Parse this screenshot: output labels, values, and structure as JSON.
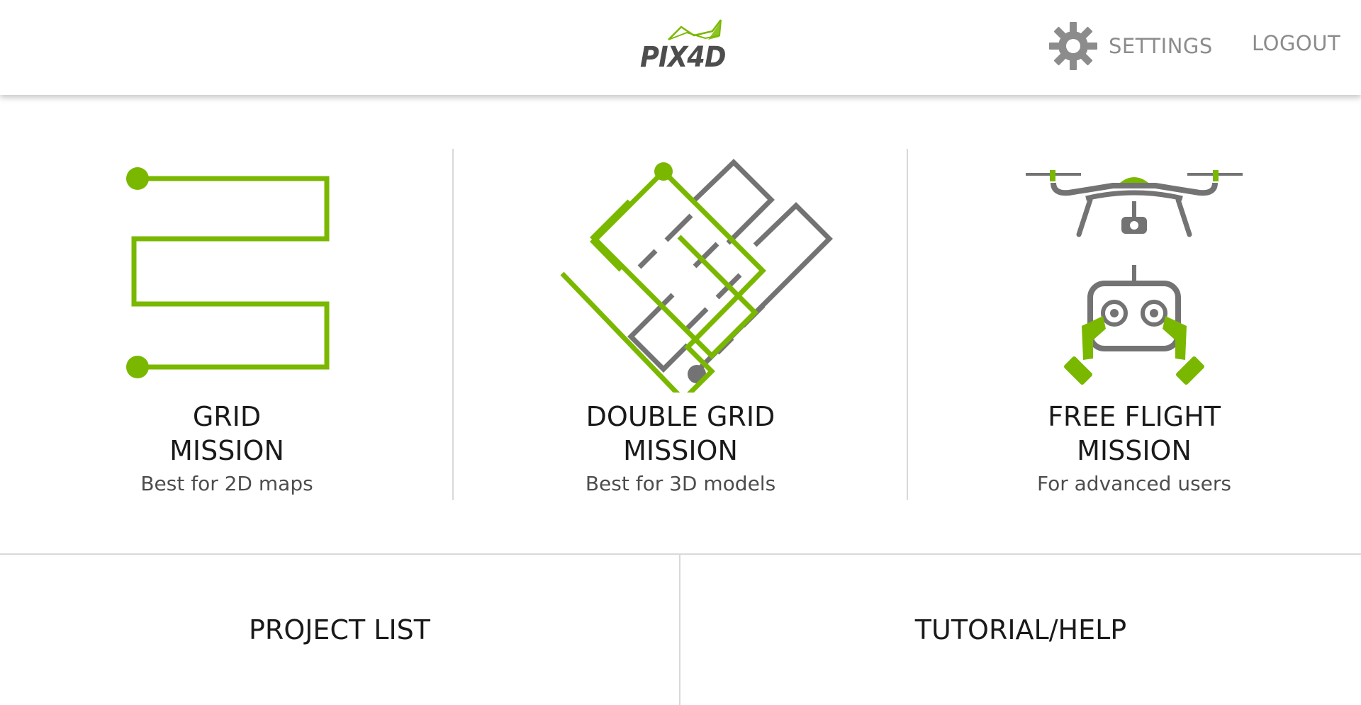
{
  "header": {
    "logo_text": "PIX4D",
    "settings_label": "SETTINGS",
    "logout_label": "LOGOUT"
  },
  "colors": {
    "accent_green": "#7ab800",
    "icon_gray": "#737373",
    "text_dark": "#1a1a1a",
    "text_light": "#8c8c8c"
  },
  "missions": [
    {
      "title_line1": "GRID",
      "title_line2": "MISSION",
      "subtitle": "Best for 2D maps",
      "icon": "grid-path-icon"
    },
    {
      "title_line1": "DOUBLE GRID",
      "title_line2": "MISSION",
      "subtitle": "Best for 3D models",
      "icon": "double-grid-path-icon"
    },
    {
      "title_line1": "FREE FLIGHT",
      "title_line2": "MISSION",
      "subtitle": "For advanced users",
      "icon": "drone-controller-icon"
    }
  ],
  "footer": {
    "project_list_label": "PROJECT LIST",
    "tutorial_label": "TUTORIAL/HELP"
  }
}
